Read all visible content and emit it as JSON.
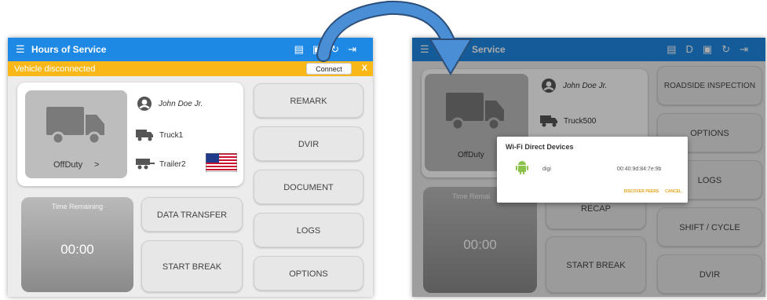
{
  "left_screen": {
    "app_title": "Hours of Service",
    "banner": {
      "text": "Vehicle disconnected",
      "connect_label": "Connect",
      "close_label": "X"
    },
    "status": "OffDuty",
    "status_chevron": ">",
    "driver_name": "John Doe Jr.",
    "truck": "Truck1",
    "trailer": "Trailer2",
    "time_remaining_label": "Time Remaining",
    "time_remaining": "00:00",
    "buttons": {
      "remark": "REMARK",
      "dvir": "DVIR",
      "document": "DOCUMENT",
      "logs": "LOGS",
      "options": "OPTIONS",
      "data_transfer": "DATA TRANSFER",
      "start_break": "START BREAK"
    }
  },
  "right_screen": {
    "app_title": "Service",
    "toolbar_d_label": "D",
    "status": "OffDuty",
    "driver_name": "John Doe Jr.",
    "truck": "Truck500",
    "time_remaining_label": "Time Remai",
    "time_remaining": "00:00",
    "buttons": {
      "roadside_inspection": "ROADSIDE INSPECTION",
      "options": "OPTIONS",
      "logs": "LOGS",
      "shift_cycle": "SHIFT / CYCLE",
      "dvir": "DVIR",
      "recap": "RECAP",
      "start_break": "START BREAK"
    },
    "dialog": {
      "title": "Wi-Fi Direct Devices",
      "device_name": "digi",
      "device_address": "00:40:9d:84:7e:9b",
      "discover_label": "DISCOVER PEERS",
      "cancel_label": "CANCEL"
    }
  },
  "colors": {
    "appbar": "#1e88e5",
    "banner": "#f9b818",
    "arrow": "#4a8fd6",
    "dialog_action": "#e6a31b"
  }
}
